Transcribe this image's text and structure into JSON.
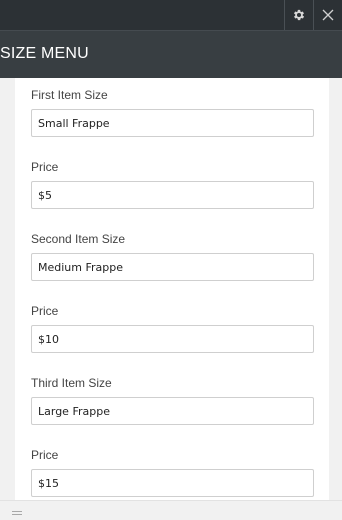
{
  "header": {
    "title": "SIZE MENU",
    "settings_icon": "gear-icon",
    "close_icon": "close-icon"
  },
  "fields": [
    {
      "label": "First Item Size",
      "value": "Small Frappe"
    },
    {
      "label": "Price",
      "value": "$5"
    },
    {
      "label": "Second Item Size",
      "value": "Medium Frappe"
    },
    {
      "label": "Price",
      "value": "$10"
    },
    {
      "label": "Third Item Size",
      "value": "Large Frappe"
    },
    {
      "label": "Price",
      "value": "$15"
    }
  ],
  "colors": {
    "topbar": "#2c3135",
    "titlebar": "#383e42",
    "panel": "#ffffff",
    "background": "#f1f1f1"
  }
}
